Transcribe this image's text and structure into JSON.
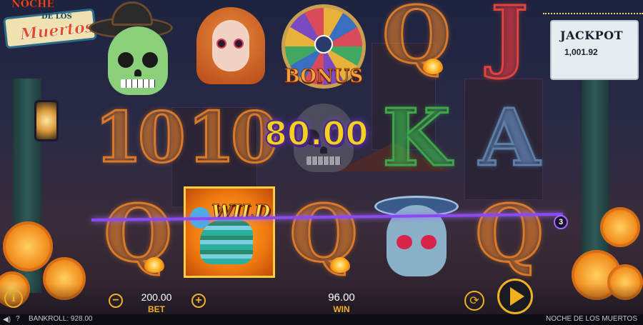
{
  "logo": {
    "line1": "NOCHE",
    "line2": "DE LOS",
    "line3": "Muertos"
  },
  "jackpot": {
    "title": "JACKPOT",
    "value": "1,001.92"
  },
  "reels": {
    "bonus_label": "BONUS",
    "wild_label": "WILD",
    "letters": {
      "r1c3": "Q",
      "r1c4": "J",
      "r2c0": "10",
      "r2c1": "10",
      "r2c3": "K",
      "r2c4": "A",
      "r3c0": "Q",
      "r3c2": "Q",
      "r3c4": "Q"
    }
  },
  "win_popup": "80.00",
  "payline_number": "3",
  "controls": {
    "bet_value": "200.00",
    "bet_label": "BET",
    "win_value": "96.00",
    "win_label": "WIN",
    "info_label": "i",
    "minus_label": "−",
    "plus_label": "+",
    "autoplay_icon": "refresh-icon",
    "spin_icon": "play-icon"
  },
  "statusbar": {
    "bankroll": "BANKROLL: 928.00",
    "game_name": "NOCHE DE LOS MUERTOS",
    "help": "?"
  },
  "colors": {
    "accent": "#f0b020",
    "payline": "#8a4af0",
    "win_popup": "#f4d020"
  }
}
